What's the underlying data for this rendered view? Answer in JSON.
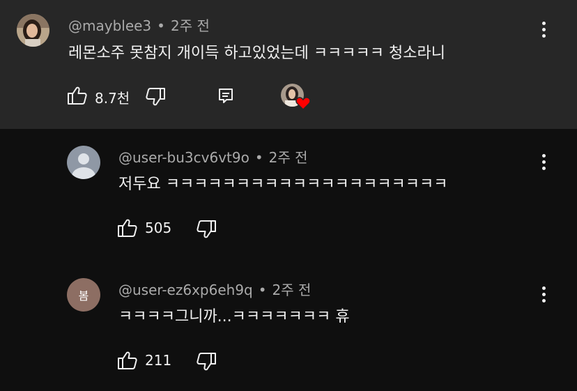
{
  "top_comment": {
    "author": "@mayblee3",
    "separator": "•",
    "time": "2주 전",
    "text": "레몬소주 못참지 개이득 하고있었는데 ㅋㅋㅋㅋㅋ  청소라니",
    "like_count": "8.7천",
    "icons": [
      "thumb-up-icon",
      "thumb-down-icon",
      "reply-icon",
      "creator-heart-icon",
      "more-vert-icon"
    ]
  },
  "replies": [
    {
      "author": "@user-bu3cv6vt9o",
      "separator": "•",
      "time": "2주 전",
      "text": "저두요 ㅋㅋㅋㅋㅋㅋㅋㅋㅋㅋㅋㅋㅋㅋㅋㅋㅋㅋㅋㅋ",
      "like_count": "505",
      "avatar_type": "default-person"
    },
    {
      "author": "@user-ez6xp6eh9q",
      "separator": "•",
      "time": "2주 전",
      "text": "ㅋㅋㅋㅋ그니까...ㅋㅋㅋㅋㅋㅋㅋ 휴",
      "like_count": "211",
      "avatar_letter": "봄",
      "avatar_color": "#8d6e63"
    }
  ],
  "colors": {
    "background": "#0f0f0f",
    "top_comment_bg": "#272727",
    "text": "#f1f1f1",
    "secondary_text": "#aaaaaa",
    "heart": "#ff0000"
  }
}
